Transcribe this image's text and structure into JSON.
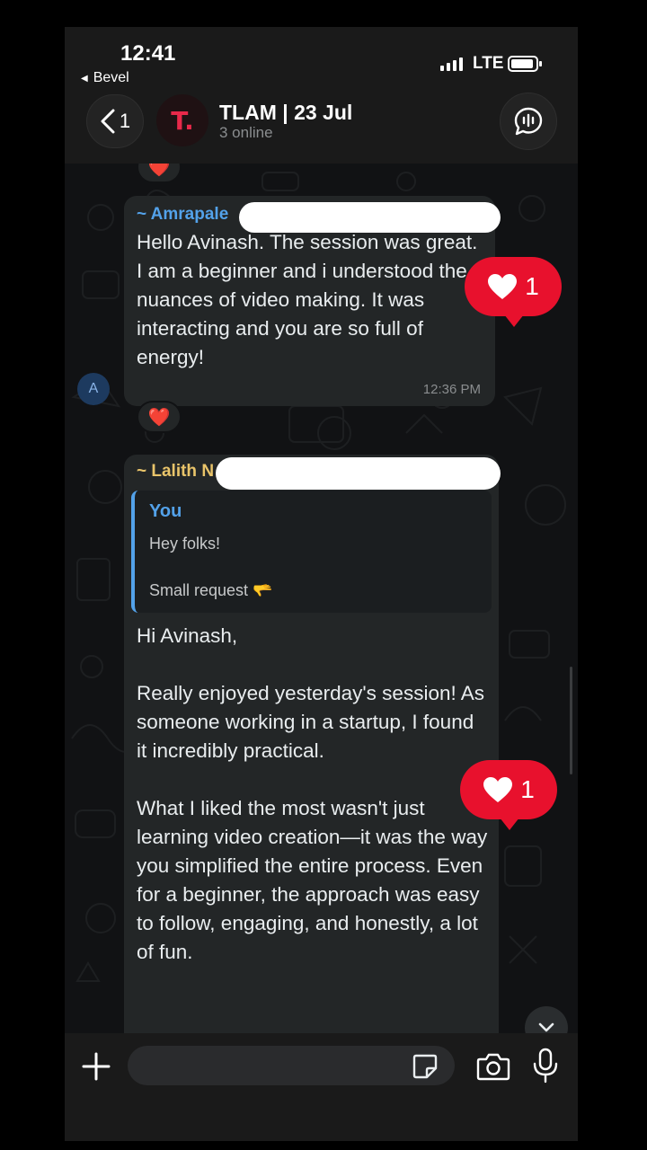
{
  "status_bar": {
    "time": "12:41",
    "back_app": "Bevel",
    "network": "LTE"
  },
  "header": {
    "back_count": "1",
    "group_logo": "T.",
    "title": "TLAM | 23 Jul",
    "subtitle": "3 online"
  },
  "messages": [
    {
      "sender": "~ Amrapale",
      "avatar_letter": "A",
      "text": "Hello Avinash. The session was great. I am a beginner and i understood the nuances of video making. It was interacting and you are so full of energy!",
      "time": "12:36 PM",
      "reaction_emoji": "❤️",
      "heart_count": "1"
    },
    {
      "sender": "~ Lalith N",
      "quote": {
        "author": "You",
        "text": "Hey folks!\n\nSmall request 🫳"
      },
      "text": "Hi Avinash,\n\nReally enjoyed yesterday's session! As someone working in a startup, I found it incredibly practical.\n\nWhat I liked the most wasn't just learning video creation—it was the way you simplified the entire process. Even for a beginner, the approach was easy to follow, engaging, and honestly, a lot of fun.",
      "heart_count": "1"
    }
  ],
  "prev_reaction_emoji": "❤️",
  "input": {
    "placeholder": ""
  },
  "colors": {
    "accent_blue": "#53a2ea",
    "accent_yellow": "#e9c46a",
    "heart_red": "#e8112d",
    "bubble": "#232627"
  }
}
